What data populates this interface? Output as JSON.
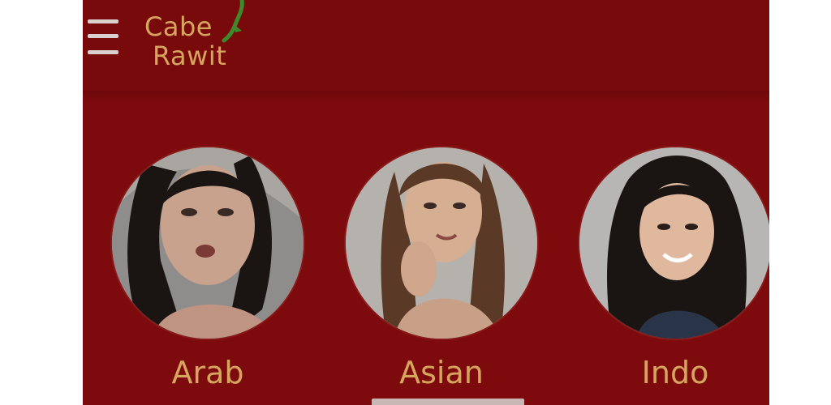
{
  "header": {
    "menu_icon": "hamburger-menu-icon",
    "logo": {
      "line1": "Cabe",
      "line2": "Rawit",
      "icon": "chili-pepper-icon"
    }
  },
  "categories": [
    {
      "label": "Arab",
      "image": "portrait-photo"
    },
    {
      "label": "Asian",
      "image": "portrait-photo"
    },
    {
      "label": "Indo",
      "image": "portrait-photo"
    }
  ],
  "colors": {
    "background": "#7d0a0c",
    "label_text": "#d7a65e",
    "logo_chili": "#3d8a2a",
    "menu_icon": "#d9d0cf",
    "outer_background": "#ffffff"
  }
}
